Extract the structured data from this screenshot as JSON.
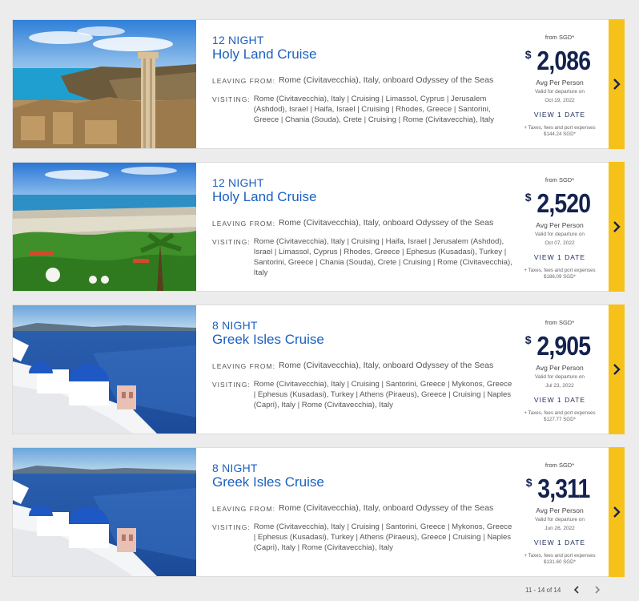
{
  "cards": [
    {
      "nights": "12 NIGHT",
      "title": "Holy Land Cruise",
      "leaving_label": "LEAVING FROM:",
      "leaving": "Rome (Civitavecchia), Italy, onboard Odyssey of the Seas",
      "visiting_label": "VISITING:",
      "visiting": "Rome (Civitavecchia), Italy  |  Cruising  |  Limassol, Cyprus  |  Jerusalem (Ashdod), Israel  |  Haifa, Israel  |  Cruising  |  Rhodes, Greece  |  Santorini, Greece  |  Chania (Souda), Crete  |  Cruising  |  Rome (Civitavecchia), Italy",
      "from": "from SGD*",
      "currency": "$",
      "price": "2,086",
      "avg": "Avg Per Person",
      "valid": "Valid for departure on",
      "date": "Oct 19, 2022",
      "view": "VIEW 1 DATE",
      "tax": "+ Taxes, fees and port expenses",
      "tax_amount": "$144.24 SGD*",
      "image": "ruins-icon"
    },
    {
      "nights": "12 NIGHT",
      "title": "Holy Land Cruise",
      "leaving_label": "LEAVING FROM:",
      "leaving": "Rome (Civitavecchia), Italy, onboard Odyssey of the Seas",
      "visiting_label": "VISITING:",
      "visiting": "Rome (Civitavecchia), Italy  |  Cruising  |  Haifa, Israel  |  Jerusalem (Ashdod), Israel  |  Limassol, Cyprus  |  Rhodes, Greece  |  Ephesus (Kusadasi), Turkey  |  Santorini, Greece  |  Chania (Souda), Crete  |  Cruising  |  Rome (Civitavecchia), Italy",
      "from": "from SGD*",
      "currency": "$",
      "price": "2,520",
      "avg": "Avg Per Person",
      "valid": "Valid for departure on",
      "date": "Oct 07, 2022",
      "view": "VIEW 1 DATE",
      "tax": "+ Taxes, fees and port expenses",
      "tax_amount": "$186.09 SGD*",
      "image": "garden-icon"
    },
    {
      "nights": "8 NIGHT",
      "title": "Greek Isles Cruise",
      "leaving_label": "LEAVING FROM:",
      "leaving": "Rome (Civitavecchia), Italy, onboard Odyssey of the Seas",
      "visiting_label": "VISITING:",
      "visiting": "Rome (Civitavecchia), Italy  |  Cruising  |  Santorini, Greece  |  Mykonos, Greece  |  Ephesus (Kusadasi), Turkey  |  Athens (Piraeus), Greece  |  Cruising  |  Naples (Capri), Italy  |  Rome (Civitavecchia), Italy",
      "from": "from SGD*",
      "currency": "$",
      "price": "2,905",
      "avg": "Avg Per Person",
      "valid": "Valid for departure on",
      "date": "Jul 23, 2022",
      "view": "VIEW 1 DATE",
      "tax": "+ Taxes, fees and port expenses",
      "tax_amount": "$127.77 SGD*",
      "image": "santorini-icon"
    },
    {
      "nights": "8 NIGHT",
      "title": "Greek Isles Cruise",
      "leaving_label": "LEAVING FROM:",
      "leaving": "Rome (Civitavecchia), Italy, onboard Odyssey of the Seas",
      "visiting_label": "VISITING:",
      "visiting": "Rome (Civitavecchia), Italy  |  Cruising  |  Santorini, Greece  |  Mykonos, Greece  |  Ephesus (Kusadasi), Turkey  |  Athens (Piraeus), Greece  |  Cruising  |  Naples (Capri), Italy  |  Rome (Civitavecchia), Italy",
      "from": "from SGD*",
      "currency": "$",
      "price": "3,311",
      "avg": "Avg Per Person",
      "valid": "Valid for departure on",
      "date": "Jun 26, 2022",
      "view": "VIEW 1 DATE",
      "tax": "+ Taxes, fees and port expenses",
      "tax_amount": "$131.60 SGD*",
      "image": "santorini-icon"
    }
  ],
  "pagination": {
    "label": "11 - 14 of 14"
  },
  "colors": {
    "brand_blue": "#1b60c0",
    "navy": "#14224f",
    "accent_yellow": "#f6c21a"
  }
}
